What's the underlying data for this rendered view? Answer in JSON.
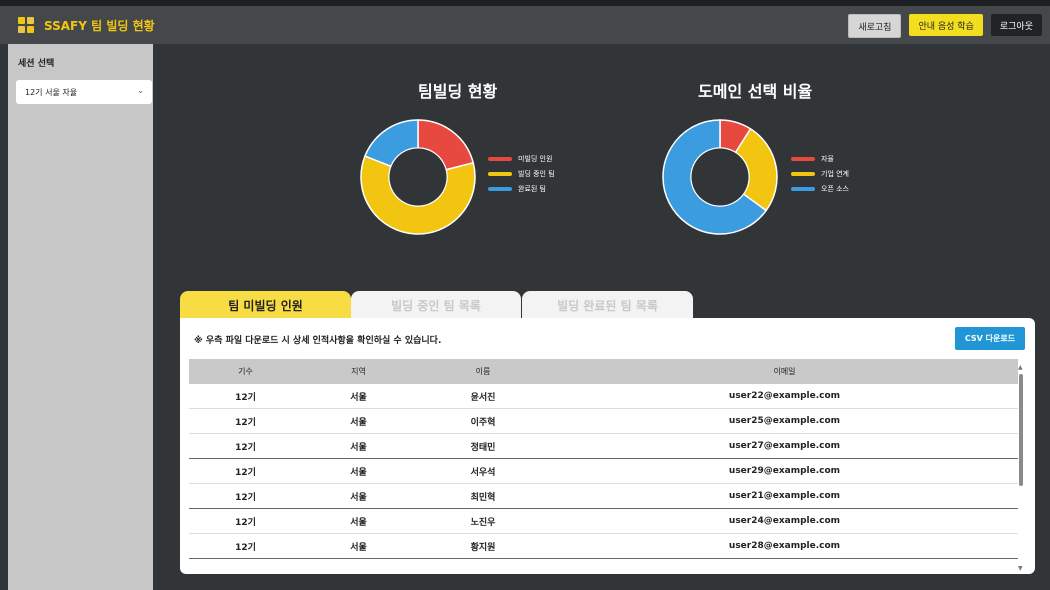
{
  "header": {
    "title": "SSAFY 팀 빌딩 현황",
    "buttons": {
      "refresh": "새로고침",
      "voice": "안내 음성 학습",
      "logout": "로그아웃"
    }
  },
  "sidebar": {
    "title": "세션 선택",
    "select_value": "12기 서울 자율"
  },
  "charts": {
    "team_status_title": "팀빌딩 현황",
    "domain_title": "도메인 선택 비율"
  },
  "chart_data": [
    {
      "type": "pie",
      "title": "팀빌딩 현황",
      "labels": [
        "미빌딩 인원",
        "빌딩 중인 팀",
        "완료된 팀"
      ],
      "values": [
        21,
        60,
        19
      ],
      "colors": [
        "#e8493f",
        "#f2c511",
        "#3b9ce0"
      ]
    },
    {
      "type": "pie",
      "title": "도메인 선택 비율",
      "labels": [
        "자율",
        "기업 연계",
        "오픈 소스"
      ],
      "values": [
        9,
        26,
        65
      ],
      "colors": [
        "#e8493f",
        "#f2c511",
        "#3b9ce0"
      ]
    }
  ],
  "tabs": {
    "unassigned": "팀 미빌딩 인원",
    "building": "빌딩 중인 팀 목록",
    "completed": "빌딩 완료된 팀 목록"
  },
  "panel": {
    "notice": "※ 우측 파일 다운로드 시 상세 인적사항을 확인하실 수 있습니다.",
    "csv_button": "CSV 다운로드"
  },
  "table": {
    "headers": [
      "기수",
      "지역",
      "이름",
      "이메일"
    ],
    "rows": [
      [
        "12기",
        "서울",
        "윤서진",
        "user22@example.com"
      ],
      [
        "12기",
        "서울",
        "이주혁",
        "user25@example.com"
      ],
      [
        "12기",
        "서울",
        "정태민",
        "user27@example.com"
      ],
      [
        "12기",
        "서울",
        "서우석",
        "user29@example.com"
      ],
      [
        "12기",
        "서울",
        "최민혁",
        "user21@example.com"
      ],
      [
        "12기",
        "서울",
        "노진우",
        "user24@example.com"
      ],
      [
        "12기",
        "서울",
        "황지원",
        "user28@example.com"
      ]
    ]
  }
}
